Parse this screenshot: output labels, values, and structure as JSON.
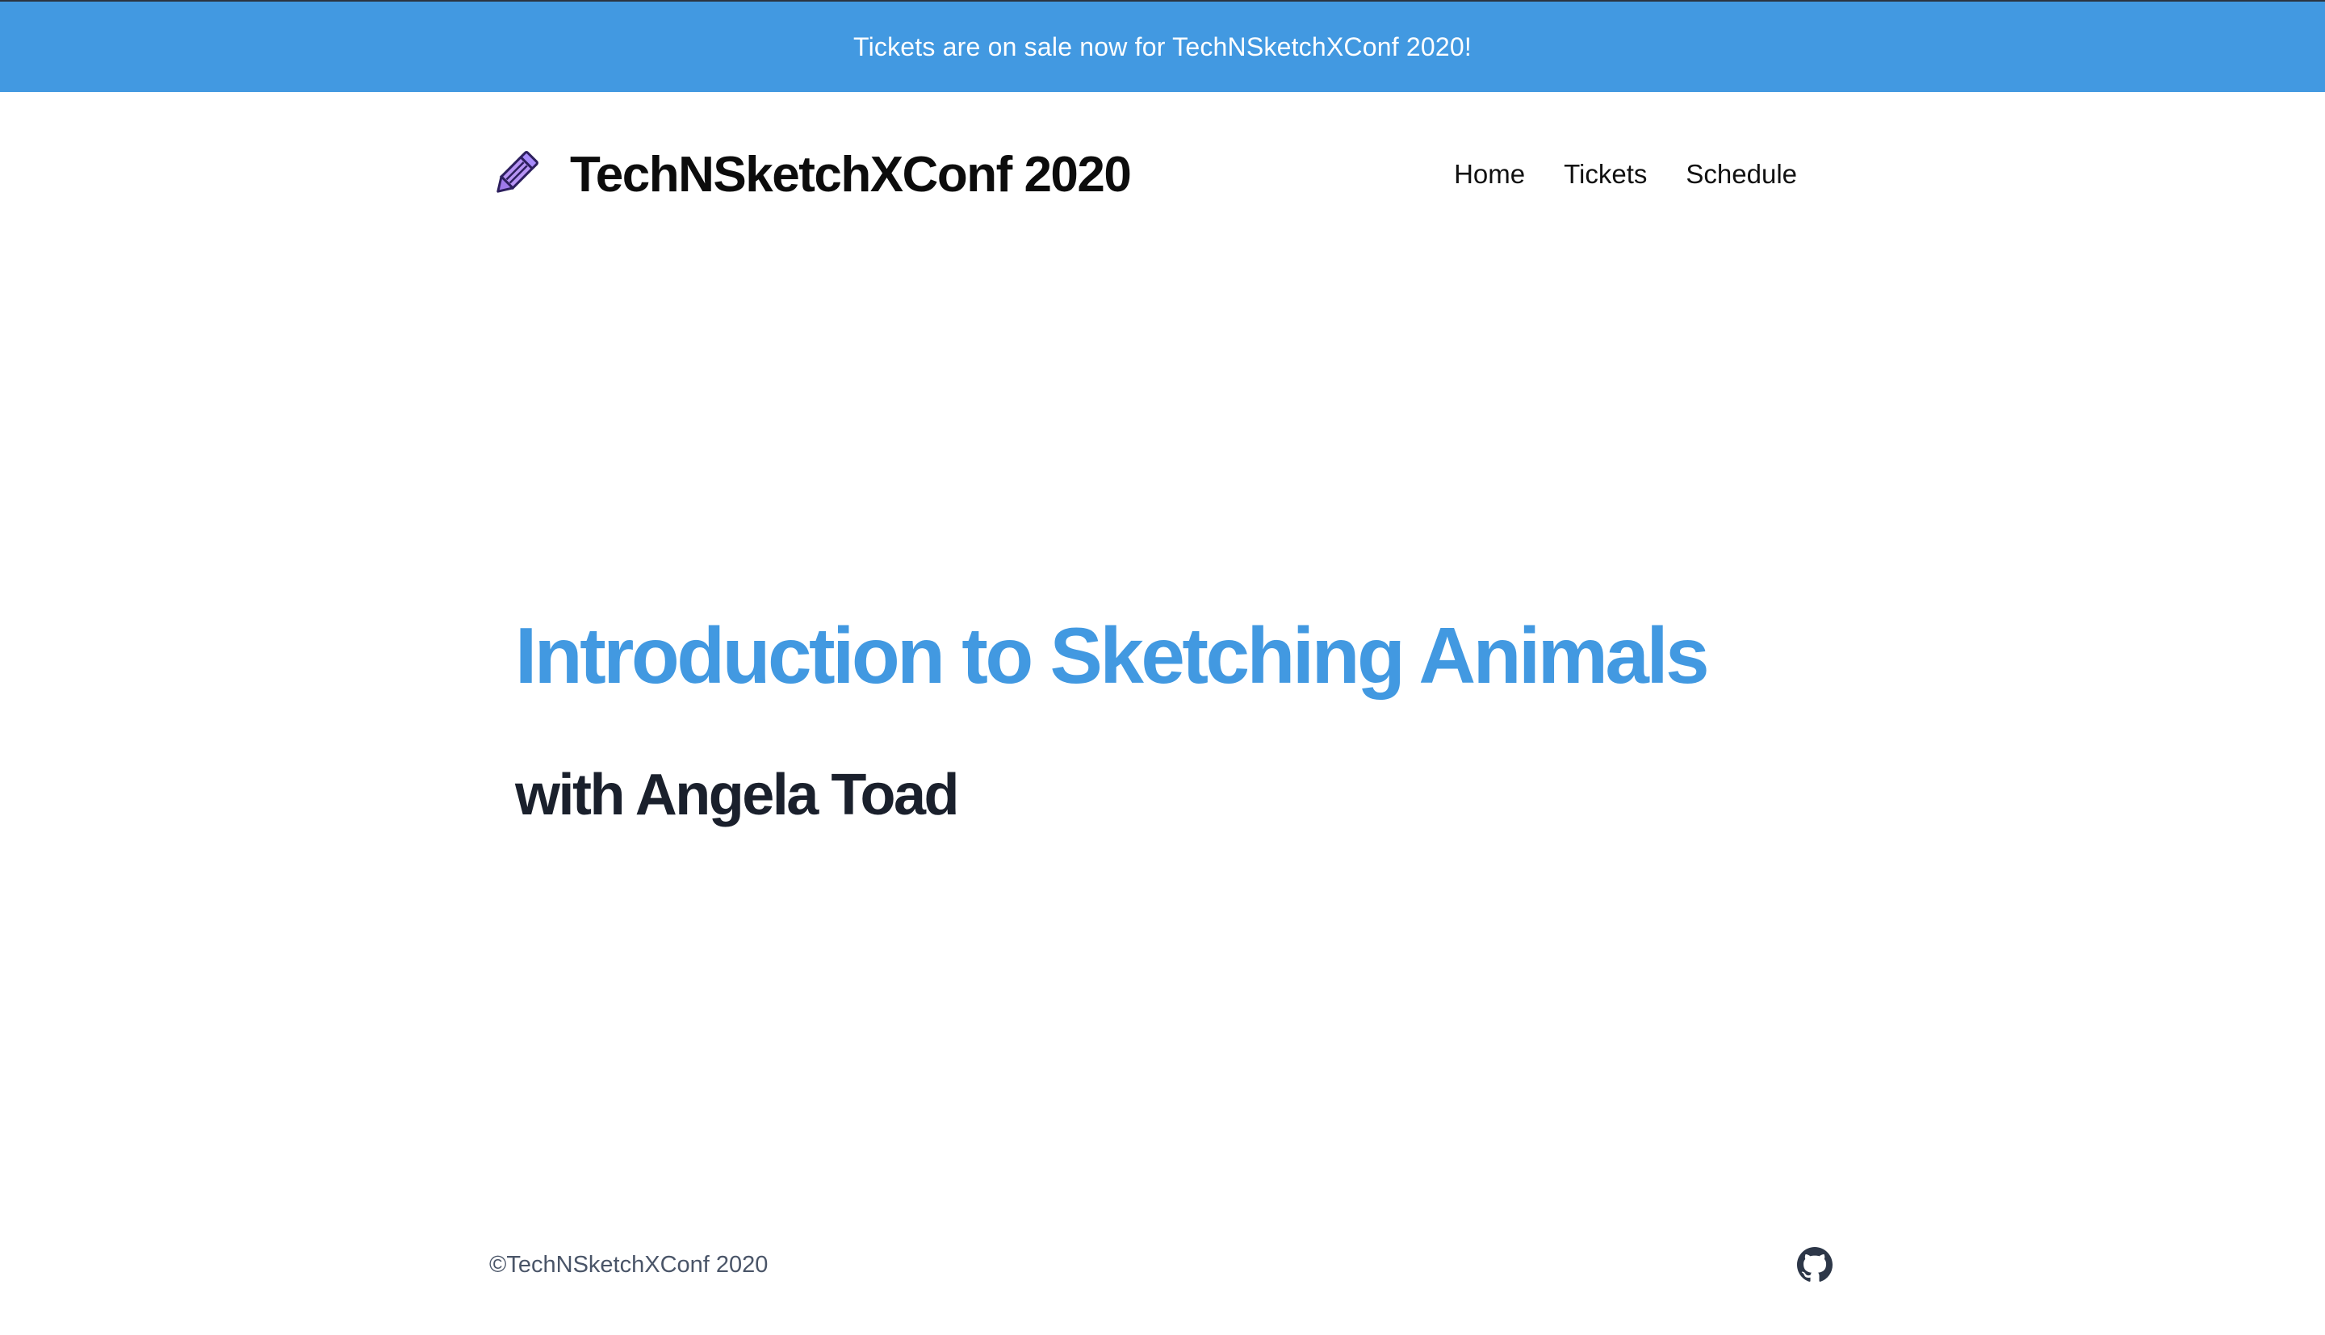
{
  "announcement": {
    "text": "Tickets are on sale now for TechNSketchXConf 2020!",
    "background": "#4299e1"
  },
  "header": {
    "logo_icon": "pencil-icon",
    "title": "TechNSketchXConf 2020",
    "nav": [
      {
        "label": "Home"
      },
      {
        "label": "Tickets"
      },
      {
        "label": "Schedule"
      }
    ]
  },
  "hero": {
    "title": "Introduction to Sketching Animals",
    "subtitle": "with Angela Toad",
    "title_color": "#4299e1",
    "subtitle_color": "#1a202c"
  },
  "footer": {
    "copyright": "©TechNSketchXConf 2020",
    "icon": "github-icon"
  }
}
